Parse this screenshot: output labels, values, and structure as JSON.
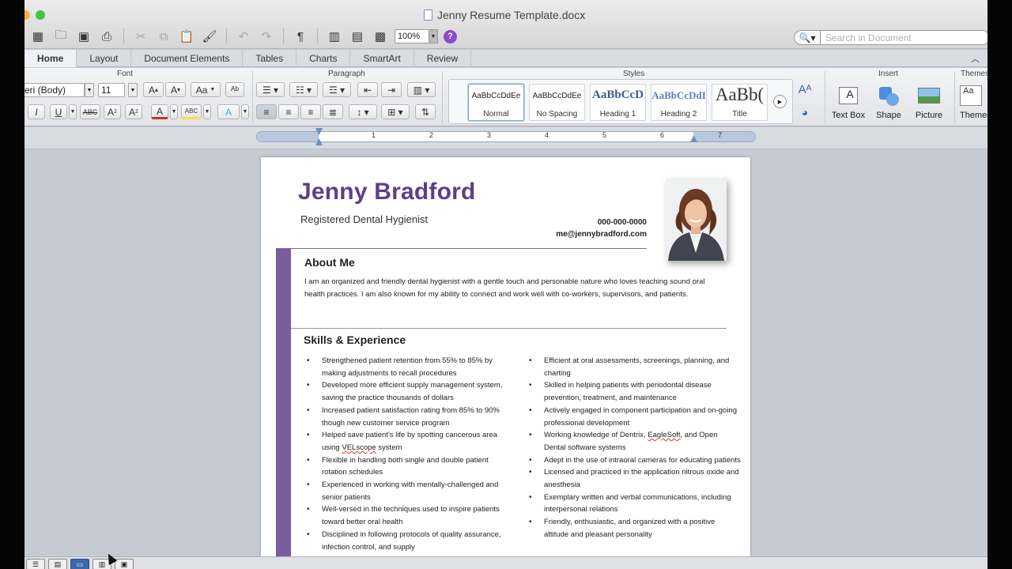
{
  "window": {
    "title": "Jenny Resume Template.docx"
  },
  "toolbar": {
    "zoom": "100%",
    "paragraph_mark": "¶",
    "help": "?"
  },
  "search": {
    "placeholder": "Search in Document"
  },
  "ribbon_tabs": [
    "Home",
    "Layout",
    "Document Elements",
    "Tables",
    "Charts",
    "SmartArt",
    "Review"
  ],
  "ribbon_groups": {
    "font": "Font",
    "paragraph": "Paragraph",
    "styles": "Styles",
    "insert": "Insert",
    "themes": "Themes"
  },
  "font": {
    "name": "eri (Body)",
    "size": "11",
    "grow": "A",
    "shrink": "A",
    "case": "Aa",
    "italic": "I",
    "underline": "U",
    "strike": "ABC",
    "superscript": "A",
    "subscript": "A",
    "highlight": "ABC"
  },
  "styles": [
    {
      "preview": "AaBbCcDdEe",
      "name": "Normal"
    },
    {
      "preview": "AaBbCcDdEe",
      "name": "No Spacing"
    },
    {
      "preview": "AaBbCcD",
      "name": "Heading 1"
    },
    {
      "preview": "AaBbCcDdI",
      "name": "Heading 2"
    },
    {
      "preview": "AaBb(",
      "name": "Title"
    }
  ],
  "insert": [
    {
      "label": "Text Box"
    },
    {
      "label": "Shape"
    },
    {
      "label": "Picture"
    }
  ],
  "themes": {
    "label": "Themes",
    "preview": "Aa"
  },
  "ruler": {
    "numbers": [
      "1",
      "2",
      "3",
      "4",
      "5",
      "6",
      "7"
    ]
  },
  "document": {
    "name": "Jenny Bradford",
    "title": "Registered Dental Hygienist",
    "phone": "000-000-0000",
    "email": "me@jennybradford.com",
    "about_heading": "About Me",
    "about_text": "I am an organized and friendly dental hygienist with a gentle touch and personable nature who loves teaching sound oral health practices. I am also known for my ability to connect and work well with co-workers, supervisors, and patients.",
    "skills_heading": "Skills & Experience",
    "skills_left": [
      "Strengthened patient retention from 55% to 85% by making adjustments to recall procedures",
      "Developed more efficient supply management system, saving the practice thousands of dollars",
      "Increased patient satisfaction rating from 85% to 90% though new customer service program",
      "Helped save patient's life by spotting cancerous area using VELscope system",
      "Flexible in handling both single and double patient rotation schedules",
      "Experienced in working with mentally-challenged and senior patients",
      "Well-versed in the techniques used to inspire patients toward better oral health",
      "Disciplined in following protocols of quality assurance, infection control, and supply"
    ],
    "skills_right": [
      "Efficient at oral assessments, screenings, planning, and charting",
      "Skilled in helping patients with periodontal disease prevention, treatment, and maintenance",
      "Actively engaged in component participation and on-going professional development",
      "Working knowledge of Dentrix, EagleSoft, and Open Dental software systems",
      "Adept in the use of intraoral cameras for educating patients",
      "Licensed and practiced in the application nitrous oxide and anesthesia",
      "Exemplary written and verbal communications, including interpersonal relations",
      "Friendly, enthusiastic, and organized with a positive attitude and pleasant personality"
    ]
  },
  "colors": {
    "accent": "#5b3f8a",
    "sidebar": "#7a5d9b",
    "help": "#8b4cc8"
  }
}
